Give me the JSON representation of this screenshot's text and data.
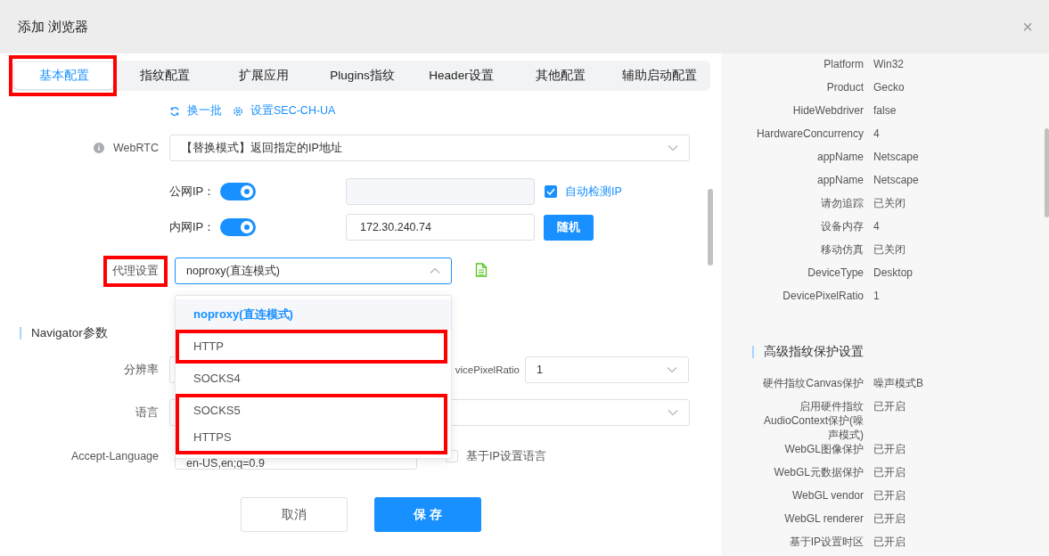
{
  "window": {
    "title": "添加 浏览器",
    "close": "×"
  },
  "tabs": [
    {
      "label": "基本配置",
      "selected": true,
      "highlighted": true
    },
    {
      "label": "指纹配置",
      "selected": false,
      "highlighted": false
    },
    {
      "label": "扩展应用",
      "selected": false,
      "highlighted": false
    },
    {
      "label": "Plugins指纹",
      "selected": false,
      "highlighted": false
    },
    {
      "label": "Header设置",
      "selected": false,
      "highlighted": false
    },
    {
      "label": "其他配置",
      "selected": false,
      "highlighted": false
    },
    {
      "label": "辅助启动配置",
      "selected": false,
      "highlighted": false
    }
  ],
  "links": [
    {
      "kind": "refresh",
      "label": "换一批"
    },
    {
      "kind": "gear",
      "label": "设置SEC-CH-UA"
    }
  ],
  "webrtc": {
    "label": "WebRTC",
    "value": "【替换模式】返回指定的IP地址"
  },
  "public_ip": {
    "label": "公网IP：",
    "on": true,
    "disabled": true,
    "auto_detect": {
      "label": "自动检测IP",
      "checked": true
    }
  },
  "private_ip": {
    "label": "内网IP：",
    "on": true,
    "value": "172.30.240.74",
    "button": "随机"
  },
  "proxy": {
    "label": "代理设置",
    "highlighted": true,
    "value": "noproxy(直连模式)",
    "expanded": true,
    "option_groups": [
      {
        "highlighted": false,
        "options": [
          {
            "label": "noproxy(直连模式)",
            "selected": true
          }
        ]
      },
      {
        "highlighted": true,
        "options": [
          {
            "label": "HTTP",
            "selected": false
          }
        ]
      },
      {
        "highlighted": false,
        "options": [
          {
            "label": "SOCKS4",
            "selected": false
          }
        ]
      },
      {
        "highlighted": true,
        "options": [
          {
            "label": "SOCKS5",
            "selected": false
          },
          {
            "label": "HTTPS",
            "selected": false
          }
        ]
      }
    ]
  },
  "navigator": {
    "title": "Navigator参数",
    "resolution_label": "分辨率",
    "pixel_ratio_label": "vicePixelRatio",
    "pixel_ratio_value": "1",
    "language_label": "语言",
    "accept_language": {
      "label": "Accept-Language",
      "value": "en-US,en;q=0.9"
    },
    "ip_language": {
      "label": "基于IP设置语言",
      "checked": false
    }
  },
  "buttons": {
    "cancel": "取消",
    "save": "保 存"
  },
  "right_panel": {
    "rows": [
      {
        "label": "Platform",
        "value": "Win32"
      },
      {
        "label": "Product",
        "value": "Gecko"
      },
      {
        "label": "HideWebdriver",
        "value": "false"
      },
      {
        "label": "HardwareConcurrency",
        "value": "4"
      },
      {
        "label": "appName",
        "value": "Netscape"
      },
      {
        "label": "appName",
        "value": "Netscape"
      },
      {
        "label": "请勿追踪",
        "value": "已关闭"
      },
      {
        "label": "设备内存",
        "value": "4"
      },
      {
        "label": "移动仿真",
        "value": "已关闭"
      },
      {
        "label": "DeviceType",
        "value": "Desktop"
      },
      {
        "label": "DevicePixelRatio",
        "value": "1"
      }
    ],
    "section": {
      "title": "高级指纹保护设置",
      "rows": [
        {
          "label": "硬件指纹Canvas保护",
          "value": "噪声模式B"
        },
        {
          "label": "启用硬件指纹AudioContext保护(噪声模式)",
          "value": "已开启"
        },
        {
          "label": "WebGL图像保护",
          "value": "已开启"
        },
        {
          "label": "WebGL元数据保护",
          "value": "已开启"
        },
        {
          "label": "WebGL vendor",
          "value": "已开启"
        },
        {
          "label": "WebGL renderer",
          "value": "已开启"
        },
        {
          "label": "基于IP设置时区",
          "value": "已开启"
        }
      ]
    }
  }
}
